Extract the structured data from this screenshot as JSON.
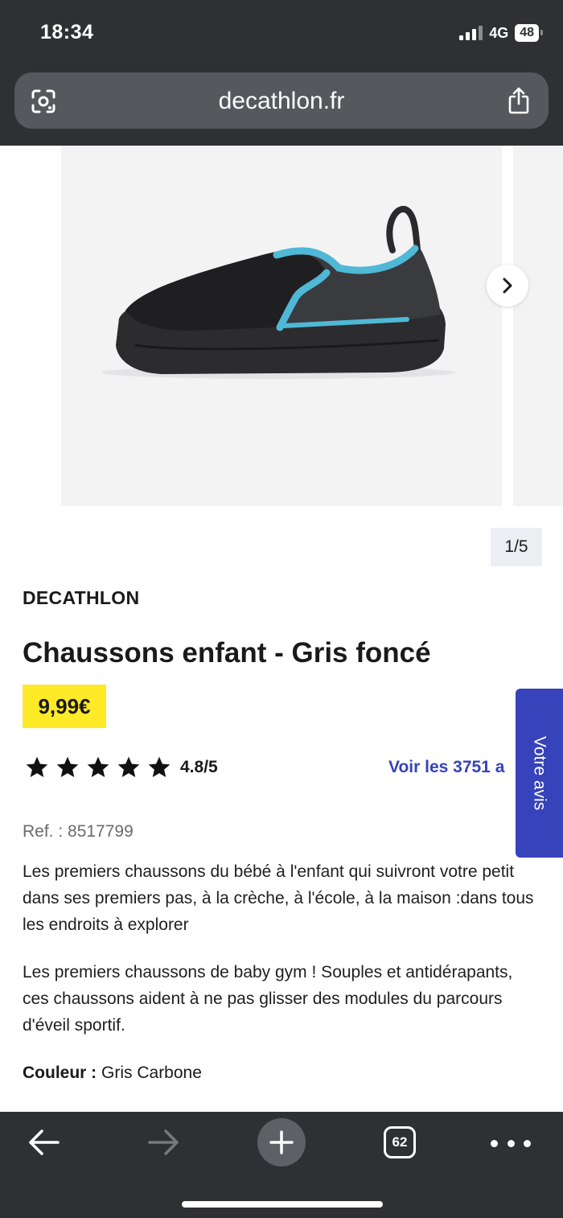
{
  "status_bar": {
    "time": "18:34",
    "network": "4G",
    "battery": "48"
  },
  "browser": {
    "url": "decathlon.fr",
    "lens_icon": "lens-icon",
    "share_icon": "share-icon"
  },
  "gallery": {
    "pager": "1/5",
    "next_icon": "chevron-right-icon"
  },
  "product": {
    "brand": "DECATHLON",
    "title": "Chaussons enfant - Gris foncé",
    "price": "9,99€",
    "rating_stars": 5,
    "rating_text": "4.8/5",
    "reviews_link": "Voir les 3751 a",
    "reference": "Ref. : 8517799",
    "description_1": "Les premiers chaussons du bébé à l'enfant qui suivront votre petit dans ses premiers pas, à la crèche, à l'école, à la maison :dans tous les endroits à explorer",
    "description_2": "Les premiers chaussons de baby gym ! Souples et antidérapants, ces chaussons aident à ne pas glisser des modules du parcours d'éveil sportif.",
    "color_label": "Couleur :",
    "color_value": "Gris Carbone"
  },
  "side_tab": {
    "label": "Votre avis"
  },
  "toolbar": {
    "tab_count": "62"
  },
  "colors": {
    "chrome": "#2e3033",
    "price_highlight": "#ffea28",
    "brand_blue": "#3643ba"
  }
}
